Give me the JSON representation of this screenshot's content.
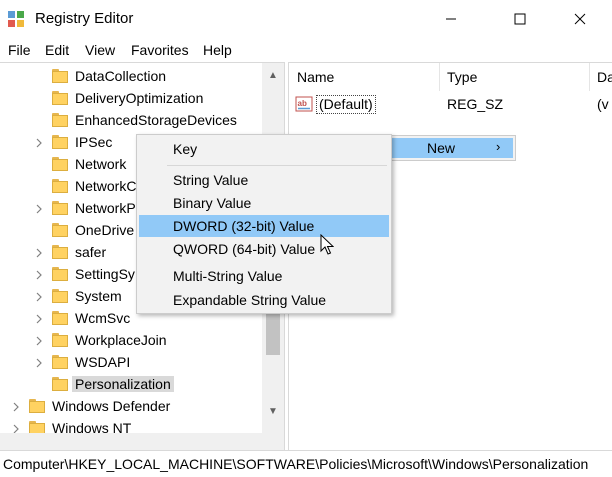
{
  "window": {
    "title": "Registry Editor",
    "controls": [
      "minimize-icon",
      "maximize-icon",
      "close-icon"
    ]
  },
  "menu": [
    "File",
    "Edit",
    "View",
    "Favorites",
    "Help"
  ],
  "tree": {
    "items": [
      {
        "label": "DataCollection",
        "expandable": false
      },
      {
        "label": "DeliveryOptimization",
        "expandable": false
      },
      {
        "label": "EnhancedStorageDevices",
        "expandable": false
      },
      {
        "label": "IPSec",
        "expandable": true
      },
      {
        "label": "Network",
        "expandable": false
      },
      {
        "label": "NetworkC",
        "expandable": false
      },
      {
        "label": "NetworkP",
        "expandable": true
      },
      {
        "label": "OneDrive",
        "expandable": false
      },
      {
        "label": "safer",
        "expandable": true
      },
      {
        "label": "SettingSy",
        "expandable": true
      },
      {
        "label": "System",
        "expandable": true
      },
      {
        "label": "WcmSvc",
        "expandable": true
      },
      {
        "label": "WorkplaceJoin",
        "expandable": true
      },
      {
        "label": "WSDAPI",
        "expandable": true
      },
      {
        "label": "Personalization",
        "expandable": false,
        "selected": true
      },
      {
        "label": "Windows Defender",
        "expandable": true,
        "level": 0
      },
      {
        "label": "Windows NT",
        "expandable": true,
        "level": 0
      }
    ]
  },
  "values_pane": {
    "columns": [
      "Name",
      "Type",
      "Da"
    ],
    "rows": [
      {
        "name": "(Default)",
        "type": "REG_SZ",
        "data": "(v"
      }
    ]
  },
  "context_menu": {
    "new_label": "New"
  },
  "submenu": {
    "items": [
      "Key",
      "String Value",
      "Binary Value",
      "DWORD (32-bit) Value",
      "QWORD (64-bit) Value",
      "Multi-String Value",
      "Expandable String Value"
    ],
    "highlighted": "DWORD (32-bit) Value"
  },
  "status_bar": {
    "path": "Computer\\HKEY_LOCAL_MACHINE\\SOFTWARE\\Policies\\Microsoft\\Windows\\Personalization"
  },
  "colors": {
    "highlight": "#91c9f7",
    "folder": "#ffd261",
    "menu_bg": "#f2f2f2"
  }
}
